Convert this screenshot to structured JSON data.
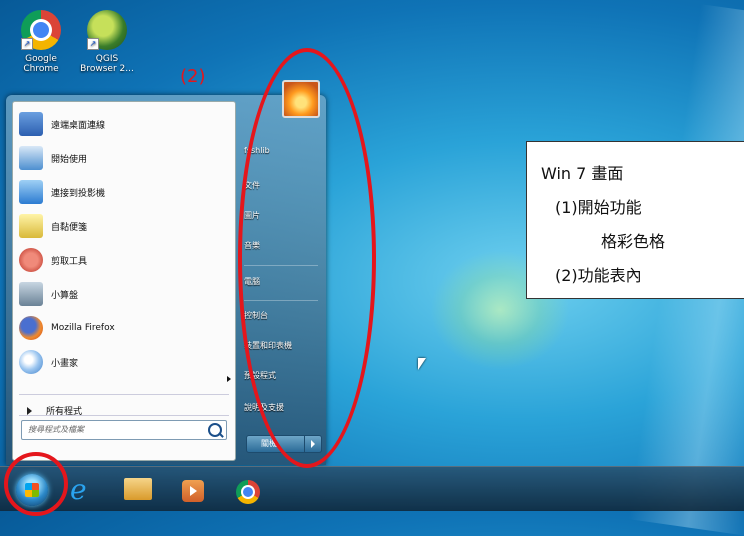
{
  "desktop": {
    "icons": [
      {
        "name": "chrome",
        "label_line1": "Google",
        "label_line2": "Chrome"
      },
      {
        "name": "qgis",
        "label_line1": "QGIS",
        "label_line2": "Browser 2..."
      }
    ]
  },
  "start_menu": {
    "left_items": [
      {
        "label": "遠端桌面連線",
        "icon": "remote-desktop-icon",
        "color": "#3a6fc7"
      },
      {
        "label": "開始使用",
        "icon": "getting-started-icon",
        "color": "#4d8fd0"
      },
      {
        "label": "連接到投影機",
        "icon": "projector-icon",
        "color": "#2c7bd1"
      },
      {
        "label": "自黏便箋",
        "icon": "sticky-notes-icon",
        "color": "#e7d55a"
      },
      {
        "label": "剪取工具",
        "icon": "snipping-tool-icon",
        "color": "#d34a3a"
      },
      {
        "label": "小算盤",
        "icon": "calculator-icon",
        "color": "#8aa0b3"
      },
      {
        "label": "Mozilla Firefox",
        "icon": "firefox-icon",
        "color": "#e8772e"
      },
      {
        "label": "小畫家",
        "icon": "paint-icon",
        "color": "#6aa0df"
      }
    ],
    "all_programs": "所有程式",
    "search_placeholder": "搜尋程式及檔案",
    "right_items": [
      {
        "label": "fsshlib"
      },
      {
        "label": "文件"
      },
      {
        "label": "圖片"
      },
      {
        "label": "音樂"
      },
      {
        "label": "電腦"
      },
      {
        "label": "控制台"
      },
      {
        "label": "裝置和印表機"
      },
      {
        "label": "預設程式"
      },
      {
        "label": "說明及支援"
      }
    ],
    "shutdown_label": "關機"
  },
  "annotation": {
    "label": "(2)",
    "note_lines": [
      "Win 7  畫面",
      "(1)開始功能",
      "格彩色格",
      "(2)功能表內"
    ],
    "color": "#e4161c"
  }
}
